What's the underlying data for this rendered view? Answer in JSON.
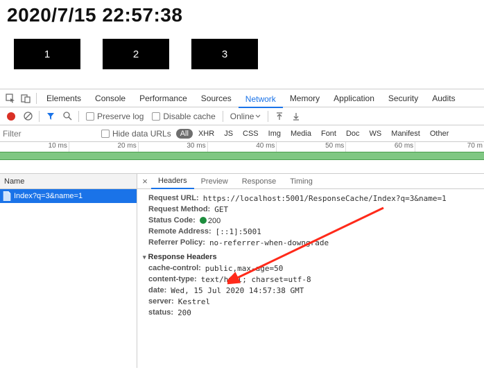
{
  "page": {
    "timestamp": "2020/7/15 22:57:38",
    "buttons": [
      "1",
      "2",
      "3"
    ]
  },
  "devtools": {
    "tabs": [
      "Elements",
      "Console",
      "Performance",
      "Sources",
      "Network",
      "Memory",
      "Application",
      "Security",
      "Audits"
    ],
    "active_tab": "Network",
    "toolbar": {
      "preserve_log": "Preserve log",
      "disable_cache": "Disable cache",
      "online": "Online"
    },
    "filter": {
      "placeholder": "Filter",
      "hide_data_urls": "Hide data URLs",
      "chips": [
        "All",
        "XHR",
        "JS",
        "CSS",
        "Img",
        "Media",
        "Font",
        "Doc",
        "WS",
        "Manifest",
        "Other"
      ]
    },
    "timeline_ticks": [
      "10 ms",
      "20 ms",
      "30 ms",
      "40 ms",
      "50 ms",
      "60 ms",
      "70 m"
    ],
    "request_list": {
      "header": "Name",
      "items": [
        "Index?q=3&name=1"
      ]
    },
    "detail": {
      "tabs": [
        "Headers",
        "Preview",
        "Response",
        "Timing"
      ],
      "active_tab": "Headers",
      "general": {
        "request_url_k": "Request URL:",
        "request_url_v": "https://localhost:5001/ResponseCache/Index?q=3&name=1",
        "request_method_k": "Request Method:",
        "request_method_v": "GET",
        "status_code_k": "Status Code:",
        "status_code_v": "200",
        "remote_address_k": "Remote Address:",
        "remote_address_v": "[::1]:5001",
        "referrer_policy_k": "Referrer Policy:",
        "referrer_policy_v": "no-referrer-when-downgrade"
      },
      "response_headers_title": "Response Headers",
      "response_headers": {
        "cache_control_k": "cache-control:",
        "cache_control_v": "public,max-age=50",
        "content_type_k": "content-type:",
        "content_type_v": "text/html; charset=utf-8",
        "date_k": "date:",
        "date_v": "Wed, 15 Jul 2020 14:57:38 GMT",
        "server_k": "server:",
        "server_v": "Kestrel",
        "status_k": "status:",
        "status_v": "200"
      }
    }
  }
}
